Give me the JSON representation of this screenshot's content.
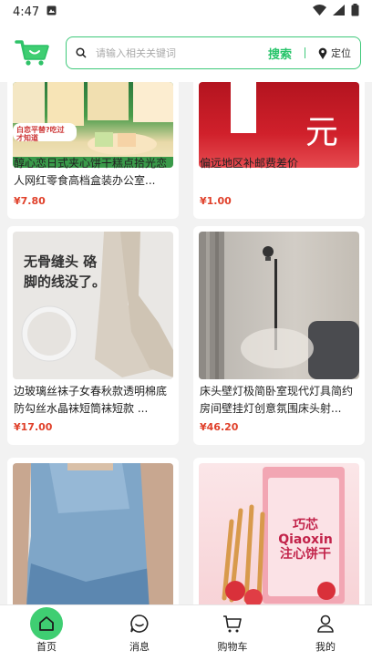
{
  "status": {
    "time": "4:47"
  },
  "header": {
    "search_placeholder": "请输入相关关键词",
    "search_button": "搜索",
    "location_label": "定位"
  },
  "products": [
    {
      "title": "醇心恋日式夹心饼干糕点拾光恋人网红零食高档盒装办公室...",
      "price": "¥7.80",
      "img_text": "白恋平替?吃过才知道"
    },
    {
      "title": "偏远地区补邮费差价",
      "price": "¥1.00",
      "img_text": "1元"
    },
    {
      "title": "边玻璃丝袜子女春秋款透明棉底防勾丝水晶袜短筒袜短款 ...",
      "price": "¥17.00",
      "img_text": "无骨缝头 硌脚的线没了。"
    },
    {
      "title": "床头壁灯极简卧室现代灯具简约房间壁挂灯创意氛围床头射...",
      "price": "¥46.20",
      "img_text": ""
    },
    {
      "title": "",
      "price": "",
      "img_text": ""
    },
    {
      "title": "",
      "price": "",
      "img_text": "巧芯 Qiaoxin 注心饼干"
    }
  ],
  "tabs": [
    {
      "label": "首页"
    },
    {
      "label": "消息"
    },
    {
      "label": "购物车"
    },
    {
      "label": "我的"
    }
  ],
  "colors": {
    "accent": "#27c46a",
    "price": "#e0402a"
  }
}
